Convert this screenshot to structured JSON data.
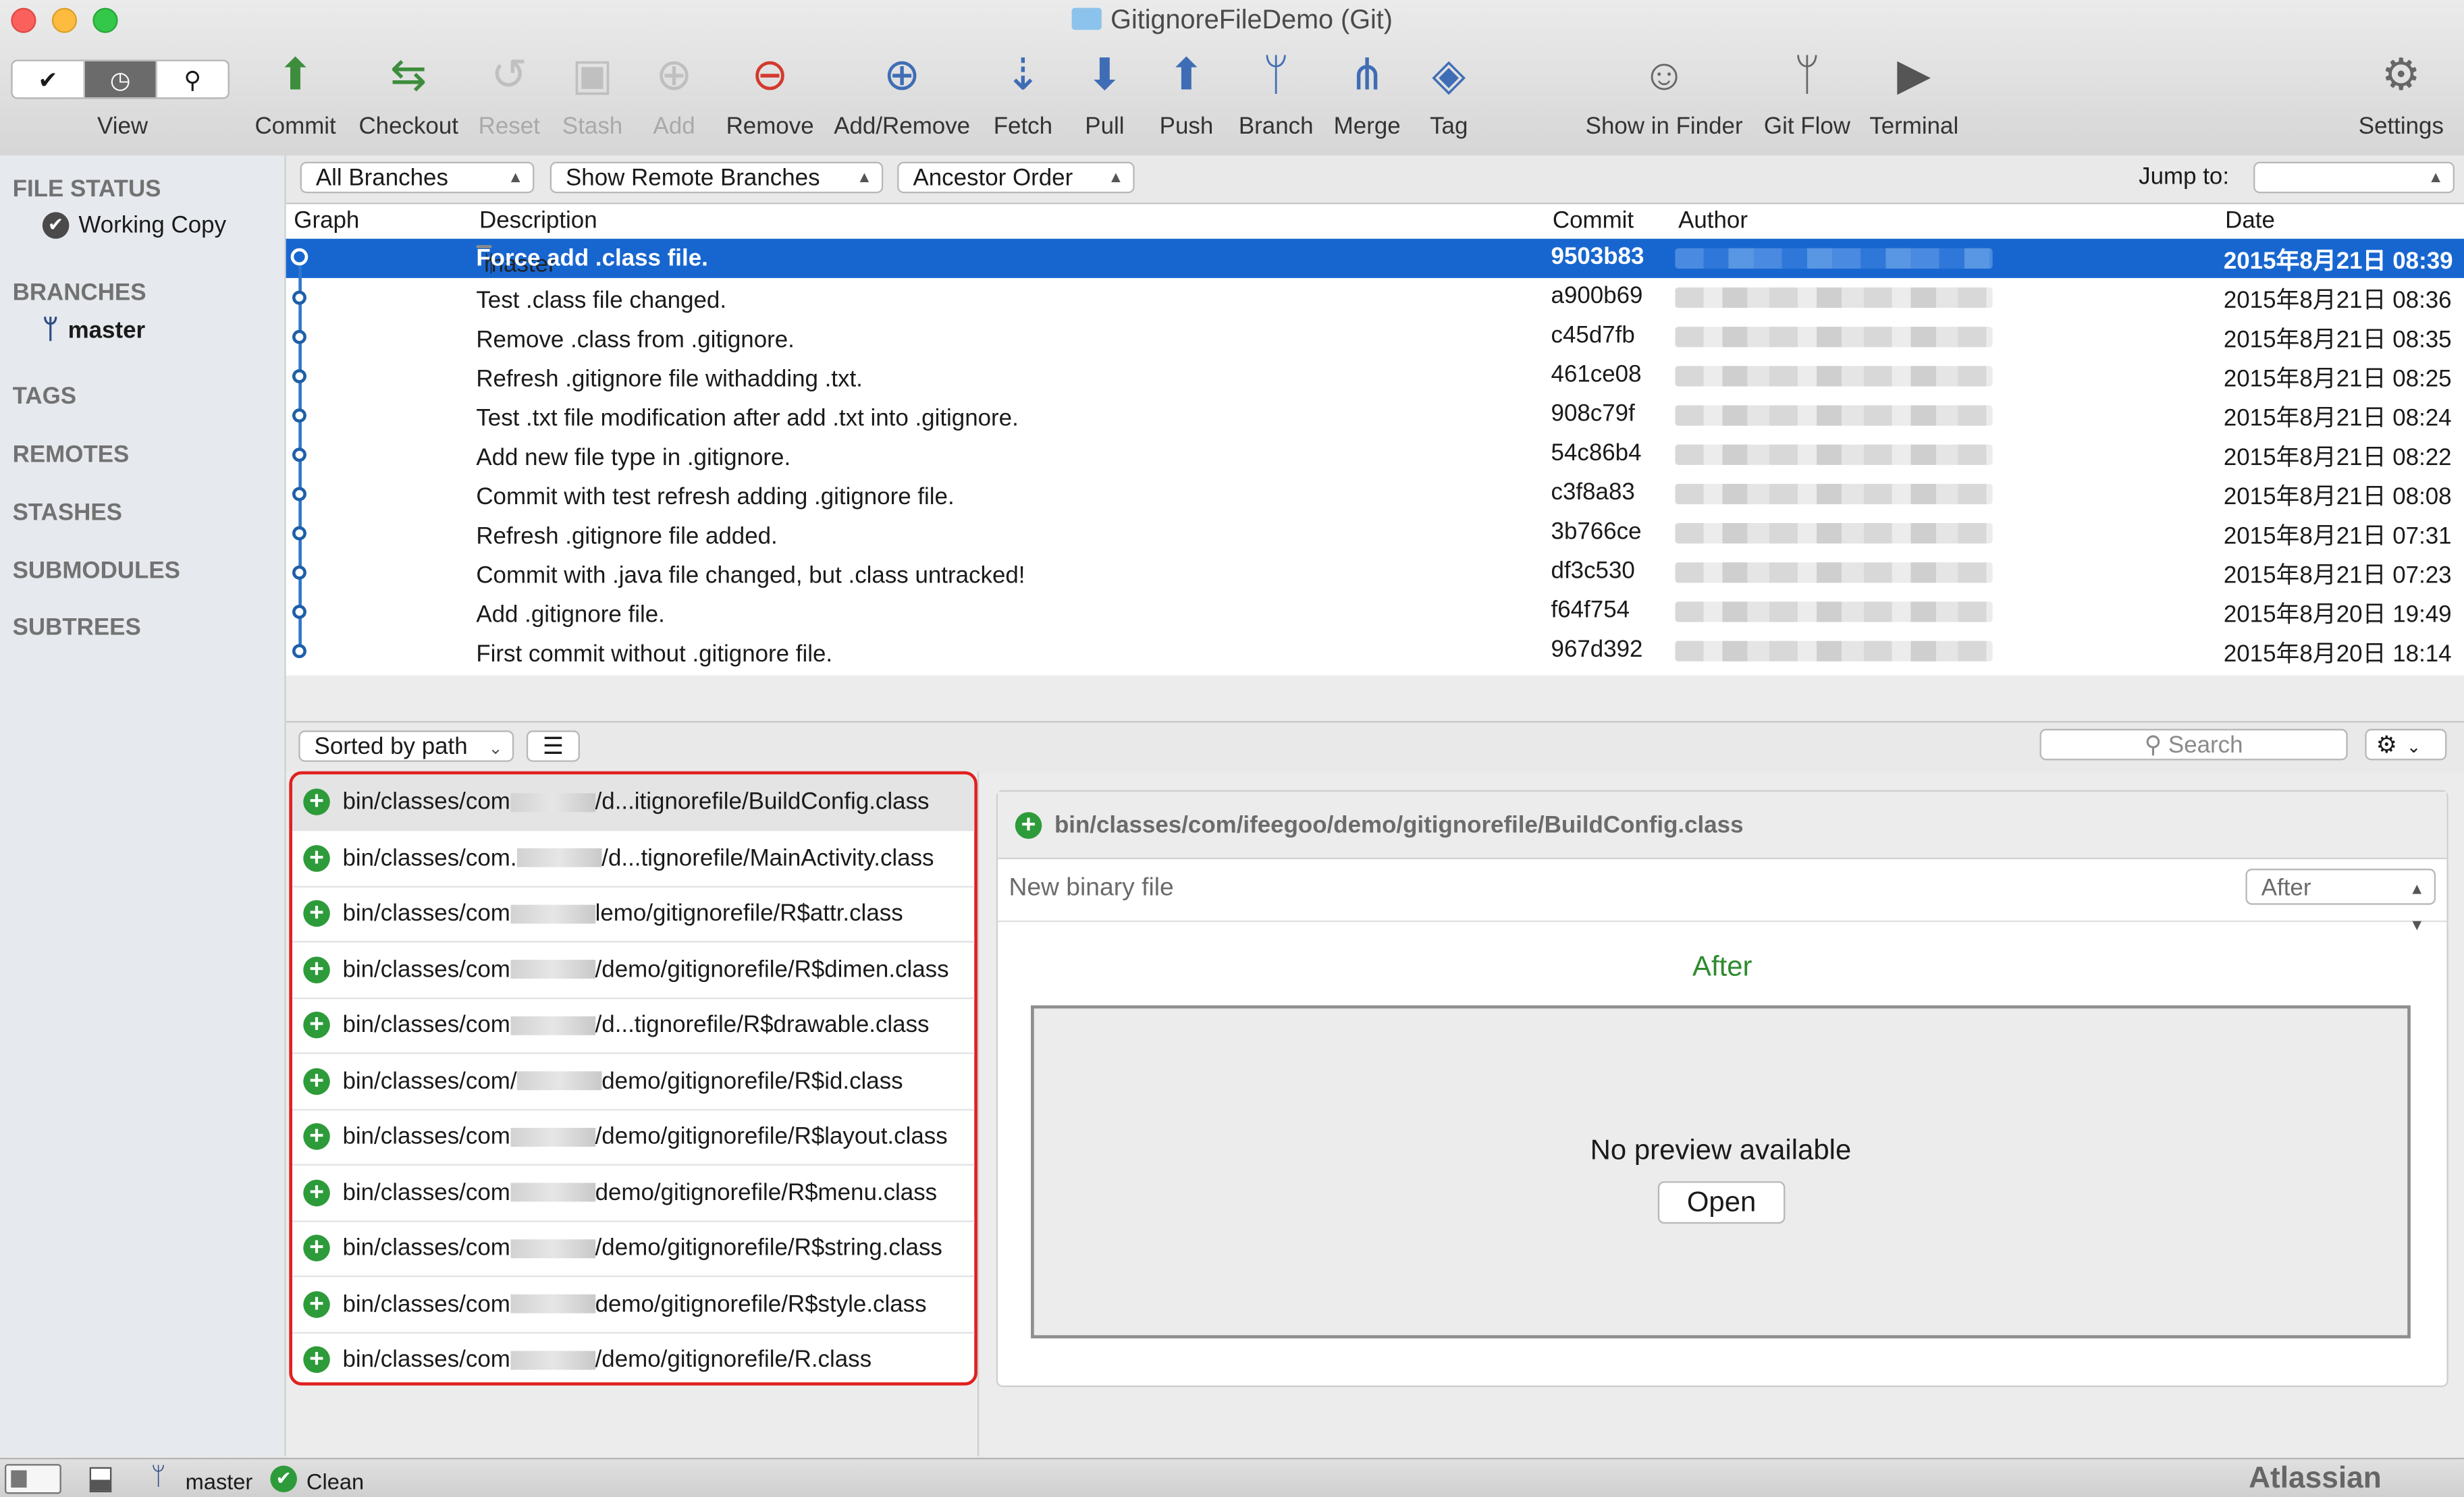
{
  "window": {
    "title": "GitignoreFileDemo (Git)"
  },
  "toolbar": {
    "view_label": "View",
    "buttons": [
      {
        "label": "Commit",
        "icon": "commit-icon"
      },
      {
        "label": "Checkout",
        "icon": "checkout-icon"
      },
      {
        "label": "Reset",
        "icon": "reset-icon",
        "disabled": true
      },
      {
        "label": "Stash",
        "icon": "stash-icon",
        "disabled": true
      },
      {
        "label": "Add",
        "icon": "add-icon",
        "disabled": true
      },
      {
        "label": "Remove",
        "icon": "remove-icon"
      },
      {
        "label": "Add/Remove",
        "icon": "add-remove-icon"
      },
      {
        "label": "Fetch",
        "icon": "fetch-icon"
      },
      {
        "label": "Pull",
        "icon": "pull-icon"
      },
      {
        "label": "Push",
        "icon": "push-icon"
      },
      {
        "label": "Branch",
        "icon": "branch-icon"
      },
      {
        "label": "Merge",
        "icon": "merge-icon"
      },
      {
        "label": "Tag",
        "icon": "tag-icon"
      },
      {
        "label": "Show in Finder",
        "icon": "finder-icon"
      },
      {
        "label": "Git Flow",
        "icon": "git-flow-icon"
      },
      {
        "label": "Terminal",
        "icon": "terminal-icon"
      },
      {
        "label": "Settings",
        "icon": "gear-icon"
      }
    ]
  },
  "sidebar": {
    "file_status": "FILE STATUS",
    "working_copy": "Working Copy",
    "branches": "BRANCHES",
    "master": "master",
    "tags": "TAGS",
    "remotes": "REMOTES",
    "stashes": "STASHES",
    "submodules": "SUBMODULES",
    "subtrees": "SUBTREES"
  },
  "filters": {
    "branches": "All Branches",
    "remote": "Show Remote Branches",
    "order": "Ancestor Order",
    "jump_to": "Jump to:"
  },
  "commits": {
    "columns": {
      "graph": "Graph",
      "description": "Description",
      "commit": "Commit",
      "author": "Author",
      "date": "Date"
    },
    "branch_tag": "master",
    "rows": [
      {
        "desc": "Force add .class file.",
        "hash": "9503b83",
        "date": "2015年8月21日 08:39"
      },
      {
        "desc": "Test .class file changed.",
        "hash": "a900b69",
        "date": "2015年8月21日 08:36"
      },
      {
        "desc": "Remove .class from .gitignore.",
        "hash": "c45d7fb",
        "date": "2015年8月21日 08:35"
      },
      {
        "desc": "Refresh .gitignore file withadding .txt.",
        "hash": "461ce08",
        "date": "2015年8月21日 08:25"
      },
      {
        "desc": "Test .txt file modification after add .txt into .gitignore.",
        "hash": "908c79f",
        "date": "2015年8月21日 08:24"
      },
      {
        "desc": "Add new file type in .gitignore.",
        "hash": "54c86b4",
        "date": "2015年8月21日 08:22"
      },
      {
        "desc": "Commit with test refresh adding .gitignore file.",
        "hash": "c3f8a83",
        "date": "2015年8月21日 08:08"
      },
      {
        "desc": "Refresh .gitignore file added.",
        "hash": "3b766ce",
        "date": "2015年8月21日 07:31"
      },
      {
        "desc": "Commit with .java file changed, but .class untracked!",
        "hash": "df3c530",
        "date": "2015年8月21日 07:23"
      },
      {
        "desc": "Add .gitignore file.",
        "hash": "f64f754",
        "date": "2015年8月20日 19:49"
      },
      {
        "desc": "First commit without .gitignore file.",
        "hash": "967d392",
        "date": "2015年8月20日 18:14"
      }
    ]
  },
  "lower": {
    "sort": "Sorted by path",
    "search_placeholder": "Search"
  },
  "files": [
    {
      "prefix": "bin/classes/com",
      "suffix": "/d...itignorefile/BuildConfig.class"
    },
    {
      "prefix": "bin/classes/com.",
      "suffix": "/d...tignorefile/MainActivity.class"
    },
    {
      "prefix": "bin/classes/com",
      "suffix": "lemo/gitignorefile/R$attr.class"
    },
    {
      "prefix": "bin/classes/com",
      "suffix": "/demo/gitignorefile/R$dimen.class"
    },
    {
      "prefix": "bin/classes/com",
      "suffix": "/d...tignorefile/R$drawable.class"
    },
    {
      "prefix": "bin/classes/com/",
      "suffix": "demo/gitignorefile/R$id.class"
    },
    {
      "prefix": "bin/classes/com",
      "suffix": "/demo/gitignorefile/R$layout.class"
    },
    {
      "prefix": "bin/classes/com",
      "suffix": "demo/gitignorefile/R$menu.class"
    },
    {
      "prefix": "bin/classes/com",
      "suffix": "/demo/gitignorefile/R$string.class"
    },
    {
      "prefix": "bin/classes/com",
      "suffix": "demo/gitignorefile/R$style.class"
    },
    {
      "prefix": "bin/classes/com",
      "suffix": "/demo/gitignorefile/R.class"
    }
  ],
  "diff": {
    "path": "bin/classes/com/ifeegoo/demo/gitignorefile/BuildConfig.class",
    "new_binary": "New binary file",
    "mode": "After",
    "heading": "After",
    "no_preview": "No preview available",
    "open": "Open"
  },
  "status": {
    "branch": "master",
    "state": "Clean",
    "brand": "Atlassian"
  },
  "colors": {
    "selection": "#1766d0",
    "added": "#2e9b3a",
    "highlight_border": "#e02020"
  }
}
